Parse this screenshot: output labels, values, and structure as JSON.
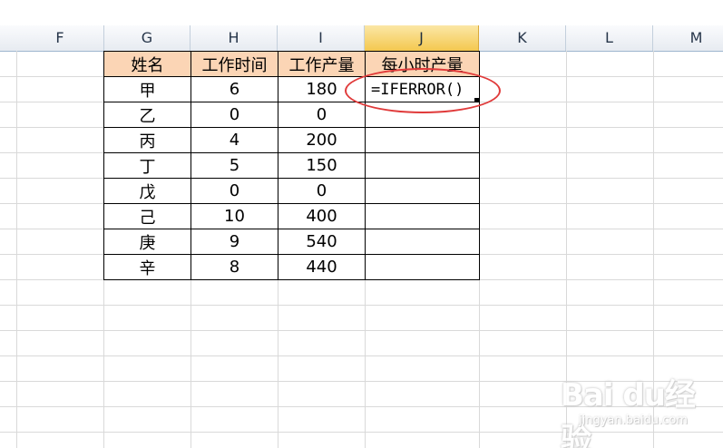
{
  "columns": [
    {
      "label": "F",
      "active": false
    },
    {
      "label": "G",
      "active": false
    },
    {
      "label": "H",
      "active": false
    },
    {
      "label": "I",
      "active": false
    },
    {
      "label": "J",
      "active": true
    },
    {
      "label": "K",
      "active": false
    },
    {
      "label": "L",
      "active": false
    },
    {
      "label": "M",
      "active": false
    }
  ],
  "table": {
    "headers": [
      "姓名",
      "工作时间",
      "工作产量",
      "每小时产量"
    ],
    "rows": [
      [
        "甲",
        "6",
        "180",
        "=IFERROR()"
      ],
      [
        "乙",
        "0",
        "0",
        ""
      ],
      [
        "丙",
        "4",
        "200",
        ""
      ],
      [
        "丁",
        "5",
        "150",
        ""
      ],
      [
        "戊",
        "0",
        "0",
        ""
      ],
      [
        "己",
        "10",
        "400",
        ""
      ],
      [
        "庚",
        "9",
        "540",
        ""
      ],
      [
        "辛",
        "8",
        "440",
        ""
      ]
    ]
  },
  "active_cell": {
    "column": "J",
    "content": "=IFERROR()"
  },
  "annotation": {
    "shape": "ellipse",
    "color": "#e03a3a"
  },
  "colors": {
    "header_fill": "#fbd5b5",
    "active_column_header": "#f4c84f",
    "gridline": "#d9d9d9"
  },
  "watermark": {
    "logo_text": "Bai du经验",
    "url_text": "jingyan.baidu.com"
  }
}
